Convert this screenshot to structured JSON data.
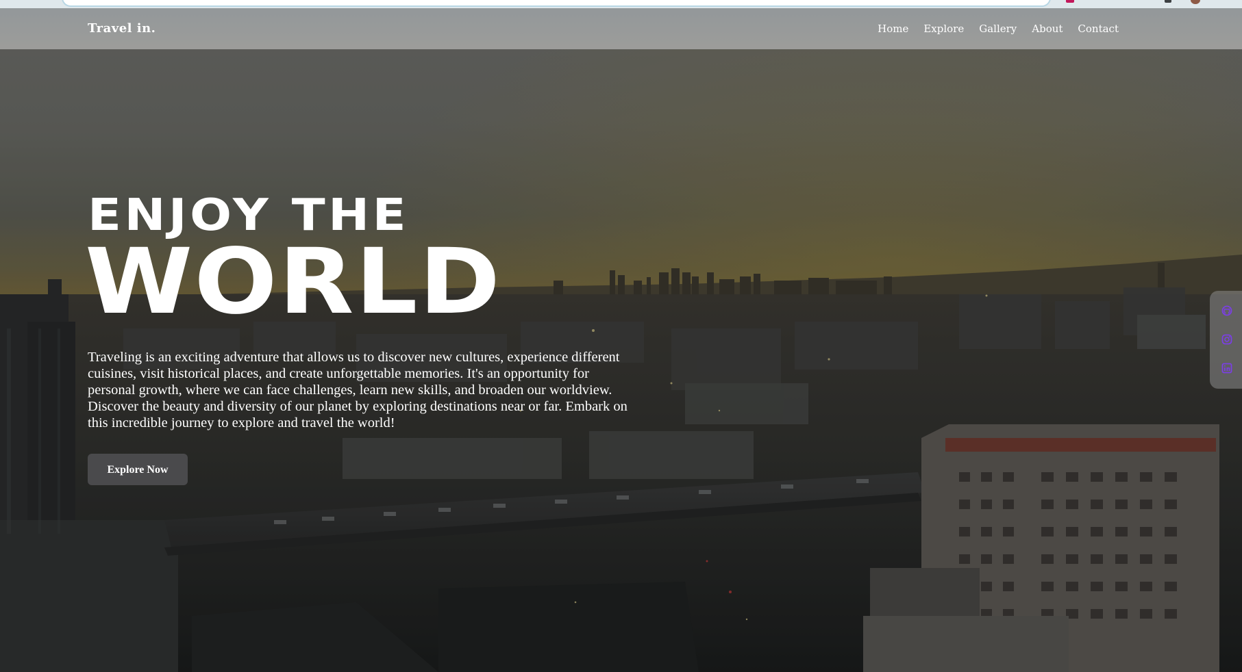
{
  "nav": {
    "brand": "Travel in.",
    "links": [
      "Home",
      "Explore",
      "Gallery",
      "About",
      "Contact"
    ]
  },
  "hero": {
    "headline_small": "ENJOY THE",
    "headline_big": "WORLD",
    "intro": "Traveling is an exciting adventure that allows us to discover new cultures, experience different cuisines, visit historical places, and create unforgettable memories. It's an opportunity for personal growth, where we can face challenges, learn new skills, and broaden our worldview. Discover the beauty and diversity of our planet by exploring destinations near or far. Embark on this incredible journey to explore and travel the world!",
    "cta_label": "Explore Now"
  },
  "social": {
    "icons": [
      "github-icon",
      "instagram-icon",
      "linkedin-icon"
    ],
    "icon_color": "#7b3fe4"
  },
  "colors": {
    "nav_bg": "#9a9c9d",
    "cta_bg": "#4a4a4c",
    "text": "#ffffff"
  }
}
